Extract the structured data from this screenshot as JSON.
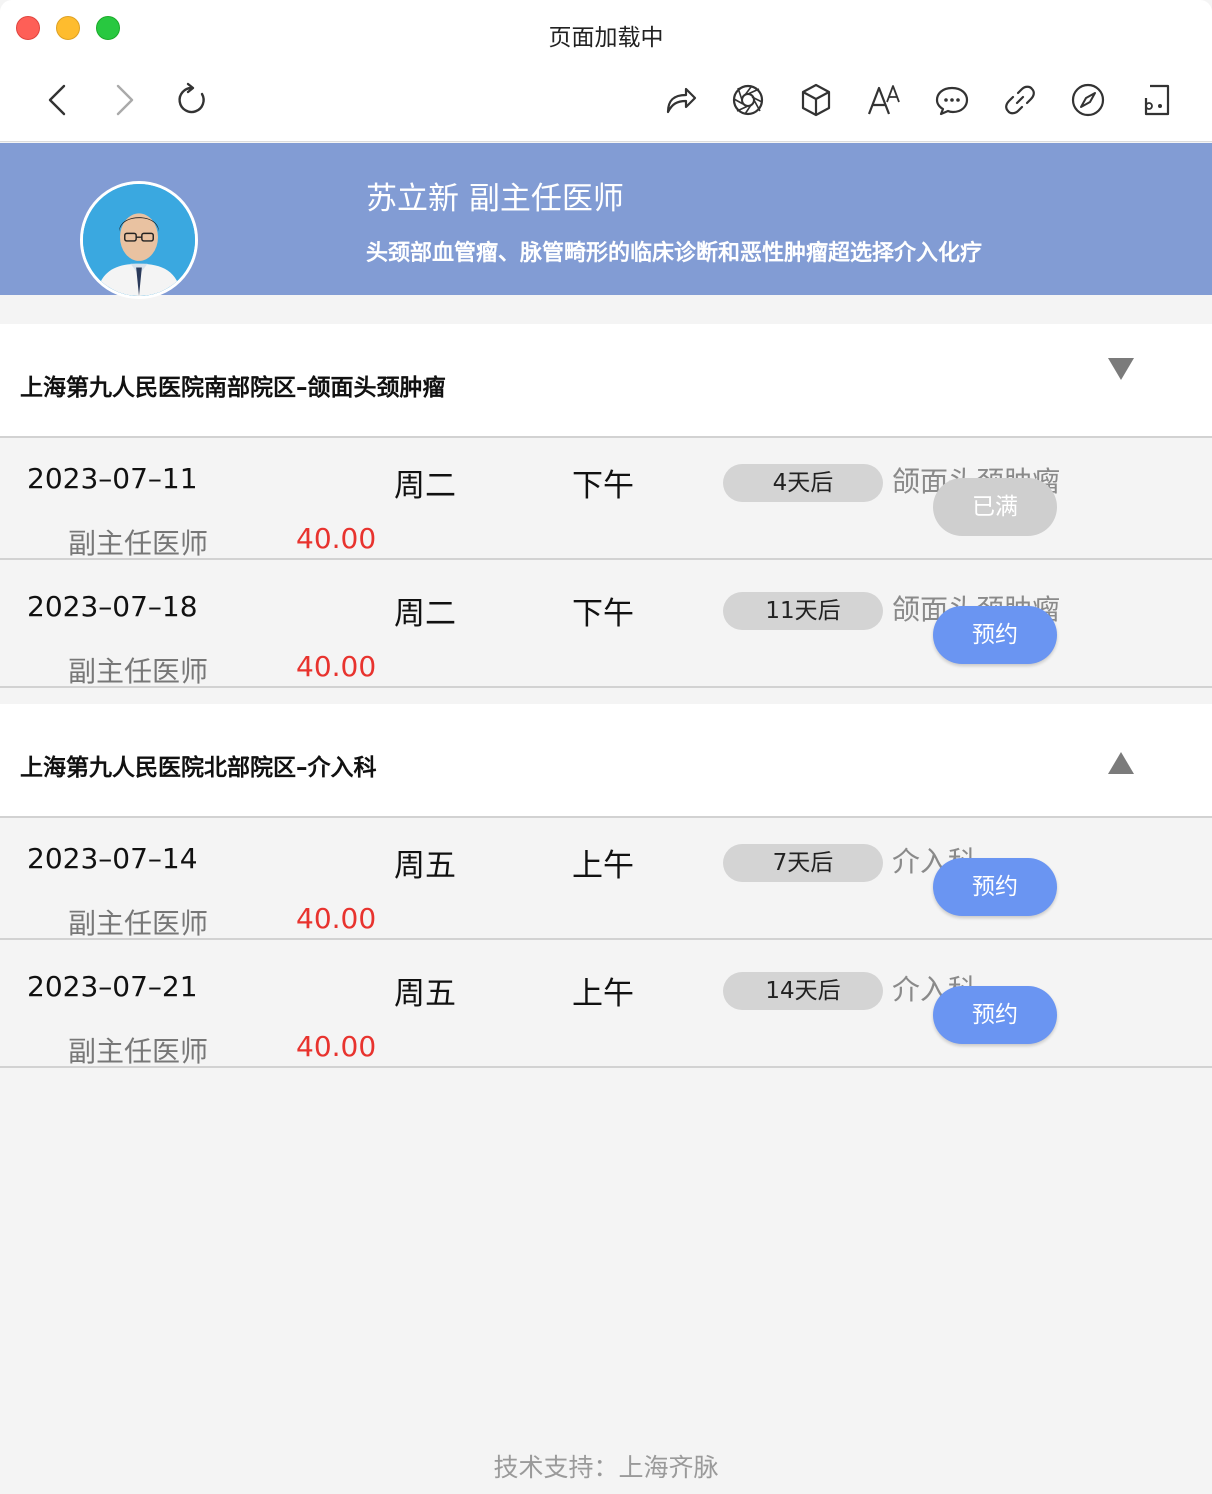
{
  "window": {
    "title": "页面加载中"
  },
  "toolbar": {
    "icons": [
      "back-icon",
      "forward-icon",
      "reload-icon",
      "share-icon",
      "aperture-icon",
      "cube-icon",
      "font-size-icon",
      "chat-icon",
      "link-icon",
      "compass-icon",
      "phone-icon"
    ]
  },
  "doctor": {
    "name_title": "苏立新 副主任医师",
    "specialty": "头颈部血管瘤、脉管畸形的临床诊断和恶性肿瘤超选择介入化疗"
  },
  "sections": [
    {
      "name": "上海第九人民医院南部院区–颌面头颈肿瘤",
      "expanded": true,
      "rows": [
        {
          "date": "2023–07–11",
          "weekday": "周二",
          "period": "下午",
          "days_after": "4天后",
          "dept": "颌面头颈肿瘤",
          "title": "副主任医师",
          "price": "40.00",
          "button": "已满",
          "available": false
        },
        {
          "date": "2023–07–18",
          "weekday": "周二",
          "period": "下午",
          "days_after": "11天后",
          "dept": "颌面头颈肿瘤",
          "title": "副主任医师",
          "price": "40.00",
          "button": "预约",
          "available": true
        }
      ]
    },
    {
      "name": "上海第九人民医院北部院区–介入科",
      "expanded": false,
      "rows": [
        {
          "date": "2023–07–14",
          "weekday": "周五",
          "period": "上午",
          "days_after": "7天后",
          "dept": "介入科",
          "title": "副主任医师",
          "price": "40.00",
          "button": "预约",
          "available": true
        },
        {
          "date": "2023–07–21",
          "weekday": "周五",
          "period": "上午",
          "days_after": "14天后",
          "dept": "介入科",
          "title": "副主任医师",
          "price": "40.00",
          "button": "预约",
          "available": true
        }
      ]
    }
  ],
  "footer": {
    "text": "技术支持：上海齐脉"
  },
  "colors": {
    "header_bg": "#829cd4",
    "book_button": "#6a95f2",
    "price": "#e8332e",
    "full_button": "#cfcfcf"
  }
}
